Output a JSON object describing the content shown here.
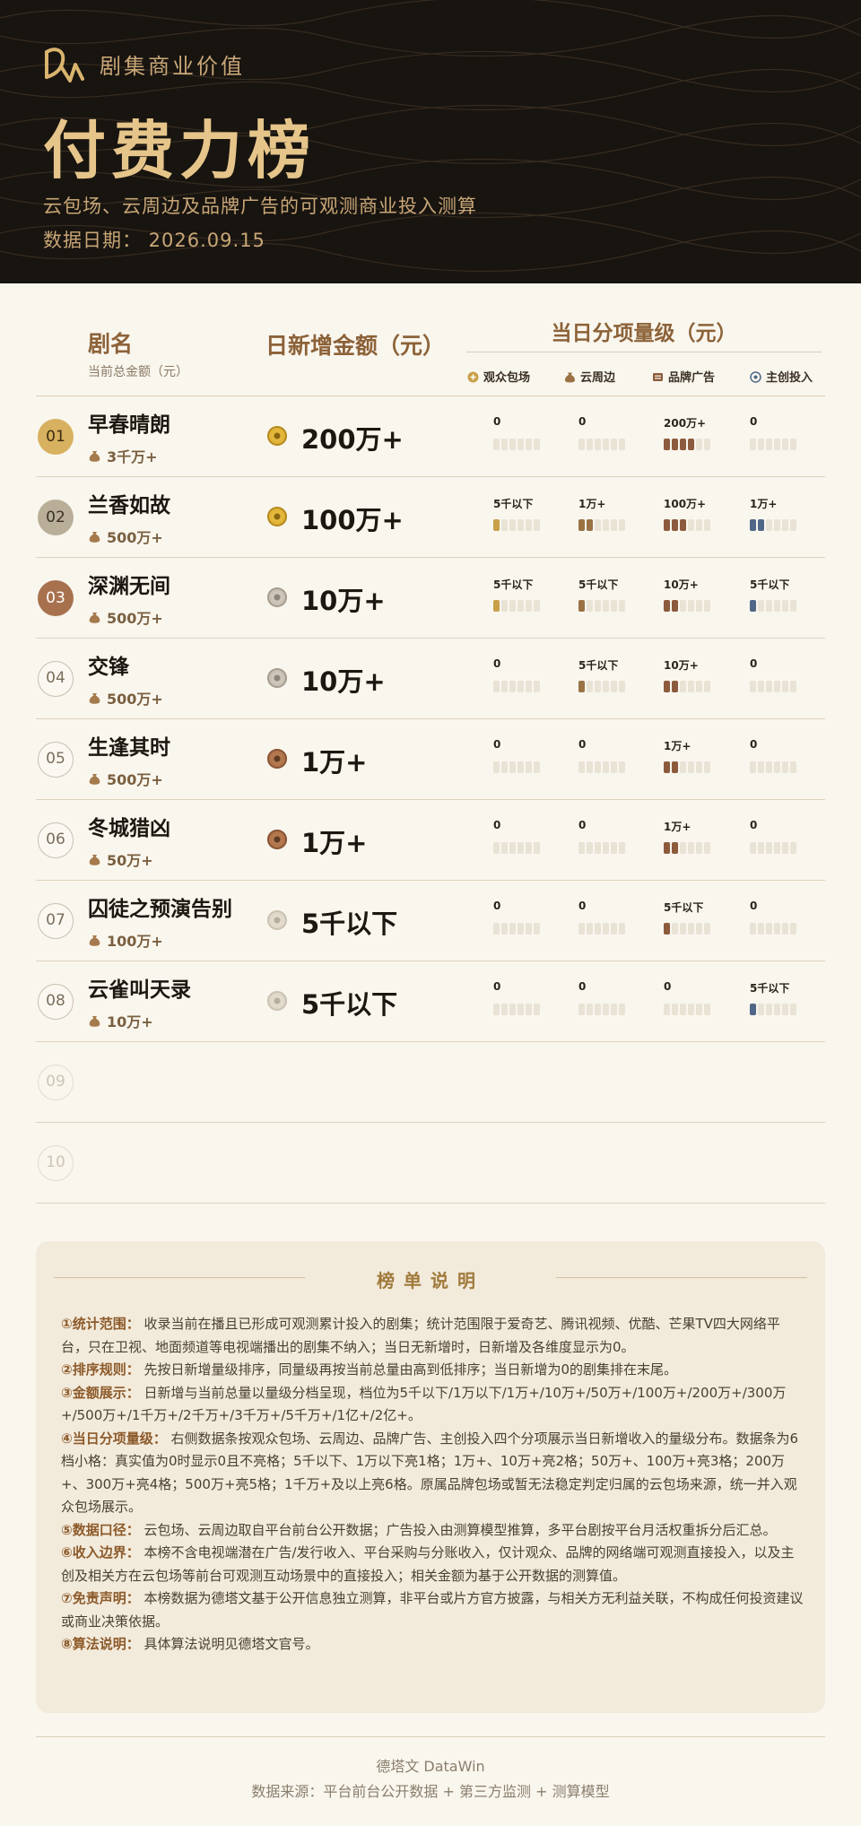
{
  "header": {
    "brand": "剧集商业价值",
    "title": "付费力榜",
    "subtitle": "云包场、云周边及品牌广告的可观测商业投入测算",
    "date": "数据日期： 2026.09.15"
  },
  "columns": {
    "name": "剧名",
    "name_sub": "当前总金额（元）",
    "amount": "日新增金额（元）",
    "breakdown": "当日分项量级（元）",
    "legend": [
      "观众包场",
      "云周边",
      "品牌广告",
      "主创投入"
    ]
  },
  "colors": {
    "background": "#f9f6ee",
    "header": "#181410",
    "gold": "#e6c58a",
    "legend": [
      "#c9a04a",
      "#9a7244",
      "#8c5a3c",
      "#4f6687"
    ]
  },
  "rows": [
    {
      "rank": "01",
      "medal": "gold",
      "name": "早春晴朗",
      "total": "3千万+",
      "coin": "gold",
      "amount": "200万+",
      "cells": [
        {
          "label": "0",
          "level": 0
        },
        {
          "label": "0",
          "level": 0
        },
        {
          "label": "200万+",
          "level": 4
        },
        {
          "label": "0",
          "level": 0
        }
      ]
    },
    {
      "rank": "02",
      "medal": "silver",
      "name": "兰香如故",
      "total": "500万+",
      "coin": "gold",
      "amount": "100万+",
      "cells": [
        {
          "label": "5千以下",
          "level": 1
        },
        {
          "label": "1万+",
          "level": 2
        },
        {
          "label": "100万+",
          "level": 3
        },
        {
          "label": "1万+",
          "level": 2
        }
      ]
    },
    {
      "rank": "03",
      "medal": "bronze",
      "name": "深渊无间",
      "total": "500万+",
      "coin": "silver",
      "amount": "10万+",
      "cells": [
        {
          "label": "5千以下",
          "level": 1
        },
        {
          "label": "5千以下",
          "level": 1
        },
        {
          "label": "10万+",
          "level": 2
        },
        {
          "label": "5千以下",
          "level": 1
        }
      ]
    },
    {
      "rank": "04",
      "medal": "plain",
      "name": "交锋",
      "total": "500万+",
      "coin": "silver",
      "amount": "10万+",
      "cells": [
        {
          "label": "0",
          "level": 0
        },
        {
          "label": "5千以下",
          "level": 1
        },
        {
          "label": "10万+",
          "level": 2
        },
        {
          "label": "0",
          "level": 0
        }
      ]
    },
    {
      "rank": "05",
      "medal": "plain",
      "name": "生逢其时",
      "total": "500万+",
      "coin": "bronze",
      "amount": "1万+",
      "cells": [
        {
          "label": "0",
          "level": 0
        },
        {
          "label": "0",
          "level": 0
        },
        {
          "label": "1万+",
          "level": 2
        },
        {
          "label": "0",
          "level": 0
        }
      ]
    },
    {
      "rank": "06",
      "medal": "plain",
      "name": "冬城猎凶",
      "total": "50万+",
      "coin": "bronze",
      "amount": "1万+",
      "cells": [
        {
          "label": "0",
          "level": 0
        },
        {
          "label": "0",
          "level": 0
        },
        {
          "label": "1万+",
          "level": 2
        },
        {
          "label": "0",
          "level": 0
        }
      ]
    },
    {
      "rank": "07",
      "medal": "plain",
      "name": "囚徒之预演告别",
      "total": "100万+",
      "coin": "pale",
      "amount": "5千以下",
      "cells": [
        {
          "label": "0",
          "level": 0
        },
        {
          "label": "0",
          "level": 0
        },
        {
          "label": "5千以下",
          "level": 1
        },
        {
          "label": "0",
          "level": 0
        }
      ]
    },
    {
      "rank": "08",
      "medal": "plain",
      "name": "云雀叫天录",
      "total": "10万+",
      "coin": "pale",
      "amount": "5千以下",
      "cells": [
        {
          "label": "0",
          "level": 0
        },
        {
          "label": "0",
          "level": 0
        },
        {
          "label": "0",
          "level": 0
        },
        {
          "label": "5千以下",
          "level": 1
        }
      ]
    },
    {
      "rank": "09",
      "medal": "faint",
      "empty": true
    },
    {
      "rank": "10",
      "medal": "faint",
      "empty": true
    }
  ],
  "notes": {
    "title": "榜单说明",
    "items": [
      {
        "label": "①统计范围：",
        "text": "收录当前在播且已形成可观测累计投入的剧集；统计范围限于爱奇艺、腾讯视频、优酷、芒果TV四大网络平台，只在卫视、地面频道等电视端播出的剧集不纳入；当日无新增时，日新增及各维度显示为0。"
      },
      {
        "label": "②排序规则：",
        "text": "先按日新增量级排序，同量级再按当前总量由高到低排序；当日新增为0的剧集排在末尾。"
      },
      {
        "label": "③金额展示：",
        "text": "日新增与当前总量以量级分档呈现，档位为5千以下/1万以下/1万+/10万+/50万+/100万+/200万+/300万+/500万+/1千万+/2千万+/3千万+/5千万+/1亿+/2亿+。"
      },
      {
        "label": "④当日分项量级：",
        "text": "右侧数据条按观众包场、云周边、品牌广告、主创投入四个分项展示当日新增收入的量级分布。数据条为6档小格：真实值为0时显示0且不亮格；5千以下、1万以下亮1格；1万+、10万+亮2格；50万+、100万+亮3格；200万+、300万+亮4格；500万+亮5格；1千万+及以上亮6格。原属品牌包场或暂无法稳定判定归属的云包场来源，统一并入观众包场展示。"
      },
      {
        "label": "⑤数据口径：",
        "text": "云包场、云周边取自平台前台公开数据；广告投入由测算模型推算，多平台剧按平台月活权重拆分后汇总。"
      },
      {
        "label": "⑥收入边界：",
        "text": "本榜不含电视端潜在广告/发行收入、平台采购与分账收入，仅计观众、品牌的网络端可观测直接投入，以及主创及相关方在云包场等前台可观测互动场景中的直接投入；相关金额为基于公开数据的测算值。"
      },
      {
        "label": "⑦免责声明：",
        "text": "本榜数据为德塔文基于公开信息独立测算，非平台或片方官方披露，与相关方无利益关联，不构成任何投资建议或商业决策依据。"
      },
      {
        "label": "⑧算法说明：",
        "text": "具体算法说明见德塔文官号。"
      }
    ]
  },
  "footer": {
    "brand": "德塔文 DataWin",
    "source": "数据来源：平台前台公开数据 + 第三方监测 + 测算模型"
  }
}
